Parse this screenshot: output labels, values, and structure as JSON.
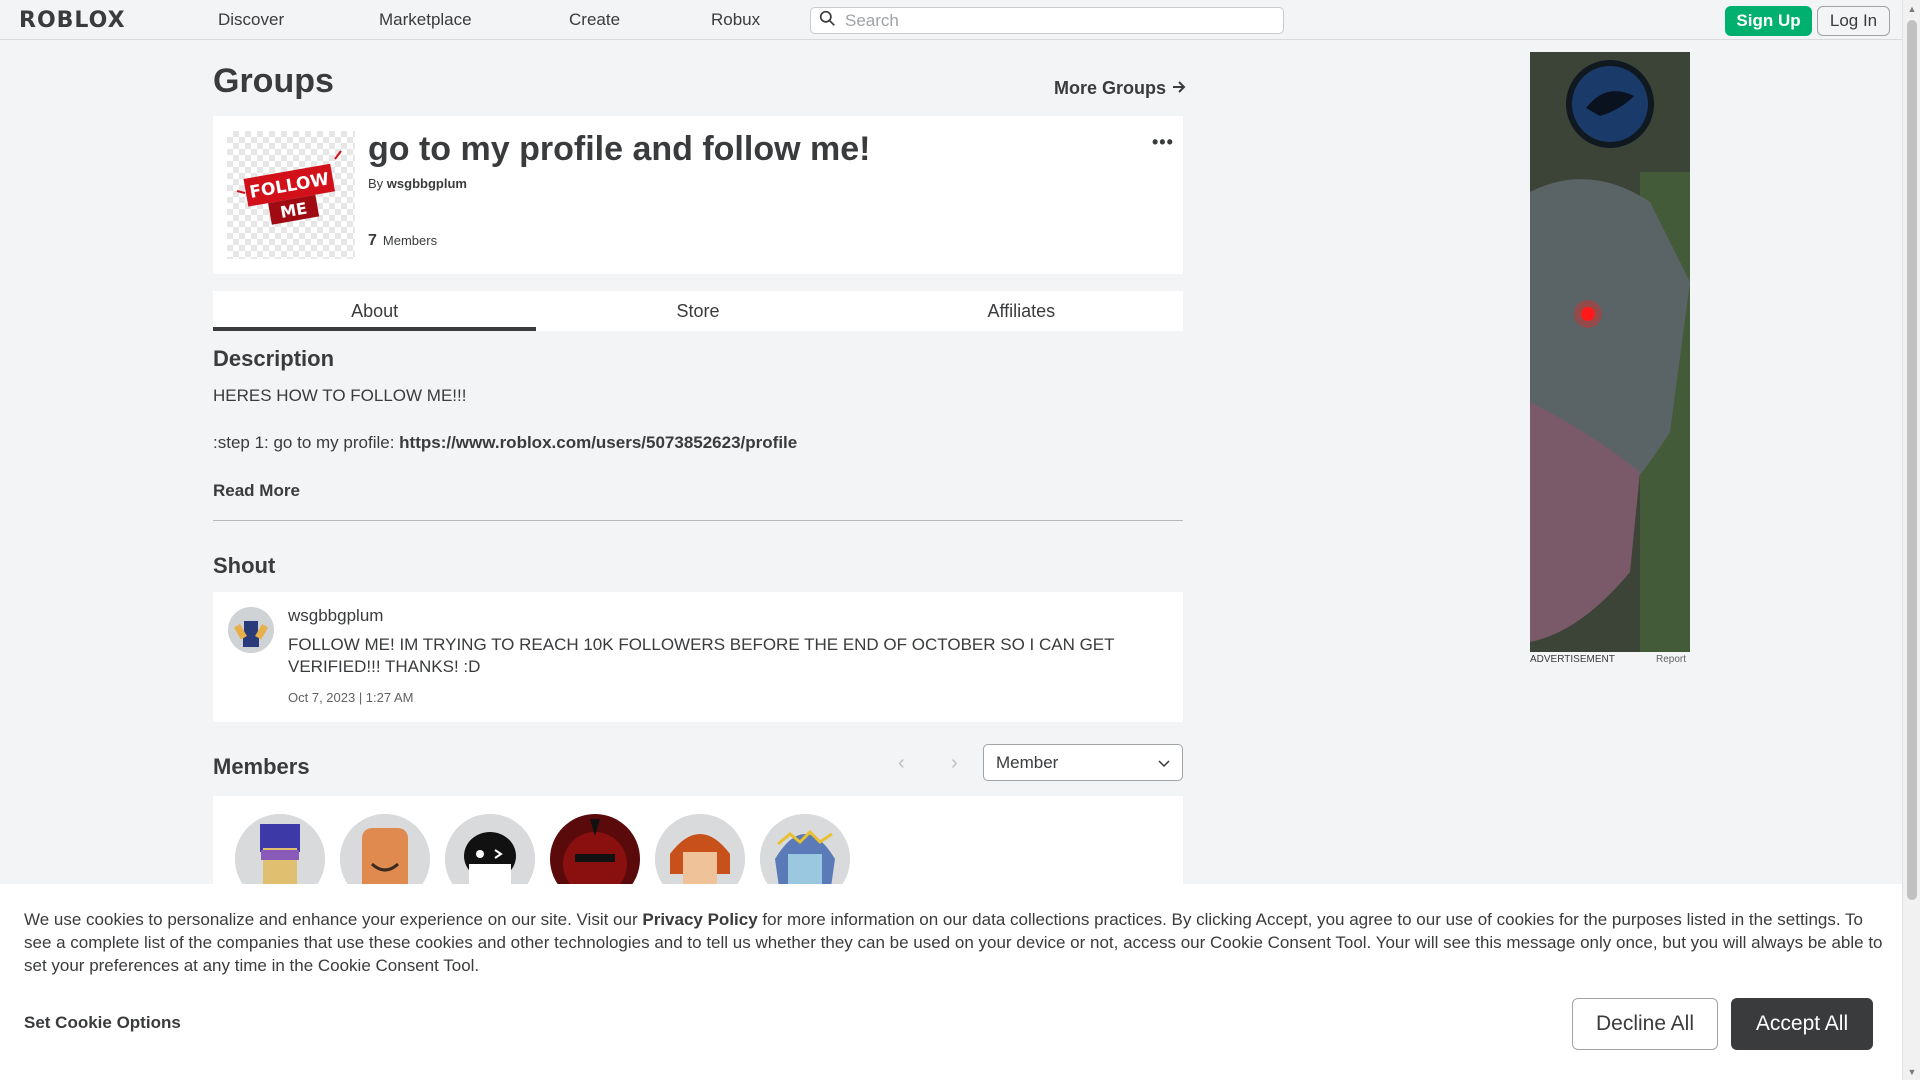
{
  "header": {
    "logo": "ROBLOX",
    "nav": [
      "Discover",
      "Marketplace",
      "Create",
      "Robux"
    ],
    "search_placeholder": "Search",
    "signup_label": "Sign Up",
    "login_label": "Log In"
  },
  "page": {
    "title": "Groups",
    "more_groups": "More Groups"
  },
  "group": {
    "name": "go to my profile and follow me!",
    "owner_prefix": "By",
    "owner": "wsgbbgplum",
    "member_count": "7",
    "members_label": "Members",
    "emblem_line1": "FOLLOW",
    "emblem_line2": "ME",
    "menu_icon": "ellipsis-icon"
  },
  "tabs": [
    "About",
    "Store",
    "Affiliates"
  ],
  "description": {
    "title": "Description",
    "line1": "HERES HOW TO FOLLOW ME!!!",
    "line2_prefix": ":step 1: go to my profile:",
    "line2_link": "https://www.roblox.com/users/5073852623/profile",
    "read_more": "Read More"
  },
  "shout": {
    "title": "Shout",
    "user": "wsgbbgplum",
    "text": "FOLLOW ME! IM TRYING TO REACH 10K FOLLOWERS BEFORE THE END OF OCTOBER SO I CAN GET VERIFIED!!! THANKS! :D",
    "date": "Oct 7, 2023 | 1:27 AM"
  },
  "members": {
    "title": "Members",
    "role_selected": "Member",
    "avatar_colors": [
      "#7a5a2a",
      "#e08a50",
      "#ffffff",
      "#7a1010",
      "#d0784a",
      "#6aa0c8"
    ]
  },
  "ad": {
    "label": "ADVERTISEMENT",
    "report": "Report"
  },
  "cookie": {
    "text_before_link": "We use cookies to personalize and enhance your experience on our site. Visit our",
    "link": "Privacy Policy",
    "text_after_link": "for more information on our data collections practices. By clicking Accept, you agree to our use of cookies for the purposes listed in the settings. To see a complete list of the companies that use these cookies and other technologies and to tell us whether they can be used on your device or not, access our Cookie Consent Tool. Your will see this message only once, but you will always be able to set your preferences at any time in the Cookie Consent Tool.",
    "options_label": "Set Cookie Options",
    "decline_label": "Decline All",
    "accept_label": "Accept All"
  }
}
